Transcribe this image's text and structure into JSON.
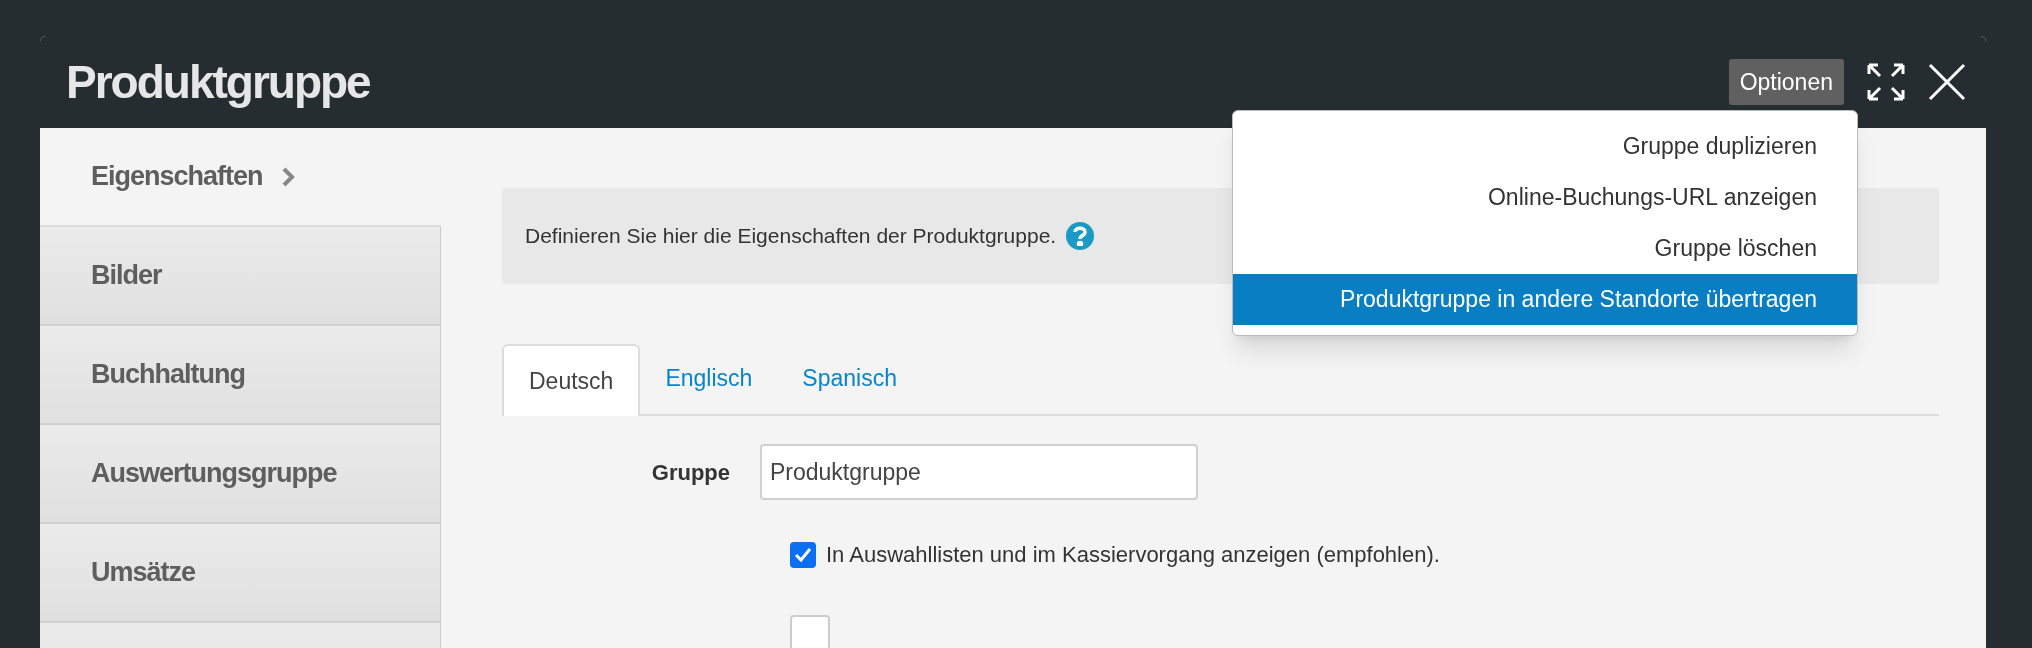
{
  "window": {
    "title": "Produktgruppe",
    "options_button": "Optionen"
  },
  "options_menu": [
    {
      "label": "Gruppe duplizieren",
      "selected": false
    },
    {
      "label": "Online-Buchungs-URL anzeigen",
      "selected": false
    },
    {
      "label": "Gruppe löschen",
      "selected": false
    },
    {
      "label": "Produktgruppe in andere Standorte übertragen",
      "selected": true
    }
  ],
  "sidebar": {
    "items": [
      {
        "label": "Eigenschaften",
        "selected": true
      },
      {
        "label": "Bilder",
        "selected": false
      },
      {
        "label": "Buchhaltung",
        "selected": false
      },
      {
        "label": "Auswertungsgruppe",
        "selected": false
      },
      {
        "label": "Umsätze",
        "selected": false
      },
      {
        "selected": false
      }
    ]
  },
  "info": "Definieren Sie hier die Eigenschaften der Produktgruppe.",
  "tabs": [
    {
      "label": "Deutsch",
      "selected": true
    },
    {
      "label": "Englisch",
      "selected": false
    },
    {
      "label": "Spanisch",
      "selected": false
    }
  ],
  "form": {
    "group_label": "Gruppe",
    "group_value": "Produktgruppe"
  },
  "checkboxes": [
    {
      "label": "In Auswahllisten und im Kassiervorgang anzeigen (empfohlen).",
      "checked": true
    },
    {
      "checked": false
    }
  ]
}
